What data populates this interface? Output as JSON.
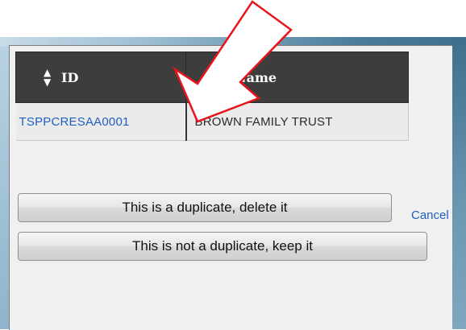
{
  "table": {
    "headers": {
      "id": "ID",
      "name": "Name"
    },
    "sort_icon": "sort-updown-icon",
    "rows": [
      {
        "id": "TSPPCRESAA0001",
        "name": "BROWN FAMILY TRUST"
      }
    ]
  },
  "actions": {
    "delete_label": "This is a duplicate, delete it",
    "keep_label": "This is not a duplicate, keep it",
    "cancel_label": "Cancel"
  },
  "colors": {
    "link": "#1f5fbf",
    "header_bg": "#3d3d3d",
    "annotation_arrow": "#e8141c"
  }
}
